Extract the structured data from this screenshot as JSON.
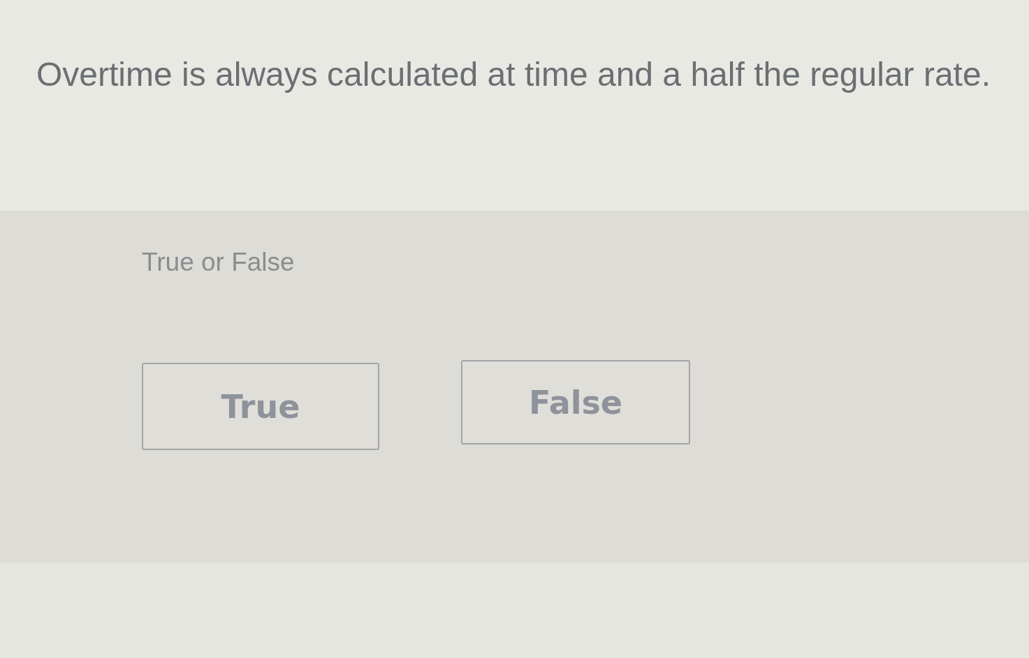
{
  "question": {
    "text": "Overtime is always calculated at time and a half the regular rate."
  },
  "answer_panel": {
    "prompt": "True or False",
    "options": [
      {
        "label": "True",
        "selected": false
      },
      {
        "label": "False",
        "selected": false
      }
    ]
  }
}
